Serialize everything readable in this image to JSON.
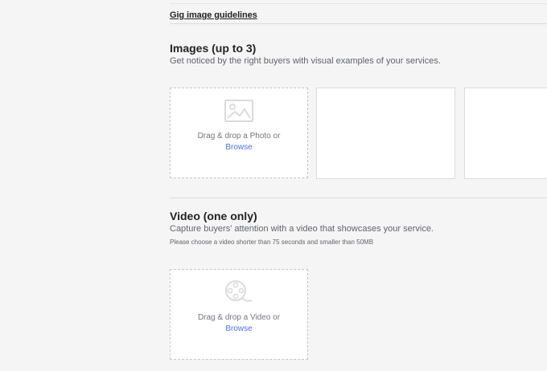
{
  "header": {
    "guidelines_link": "Gig image guidelines"
  },
  "images_section": {
    "title": "Images (up to 3)",
    "subtitle": "Get noticed by the right buyers with visual examples of your services.",
    "dropzone": {
      "icon": "photo-icon",
      "text": "Drag & drop a Photo or",
      "browse": "Browse"
    }
  },
  "video_section": {
    "title": "Video (one only)",
    "subtitle": "Capture buyers' attention with a video that showcases your service.",
    "note": "Please choose a video shorter than 75 seconds and smaller than 50MB",
    "dropzone": {
      "icon": "film-reel-icon",
      "text": "Drag & drop a Video or",
      "browse": "Browse"
    }
  },
  "colors": {
    "background": "#f5f5f5",
    "link_blue": "#4a73e8",
    "icon_gray": "#dadbdd"
  }
}
